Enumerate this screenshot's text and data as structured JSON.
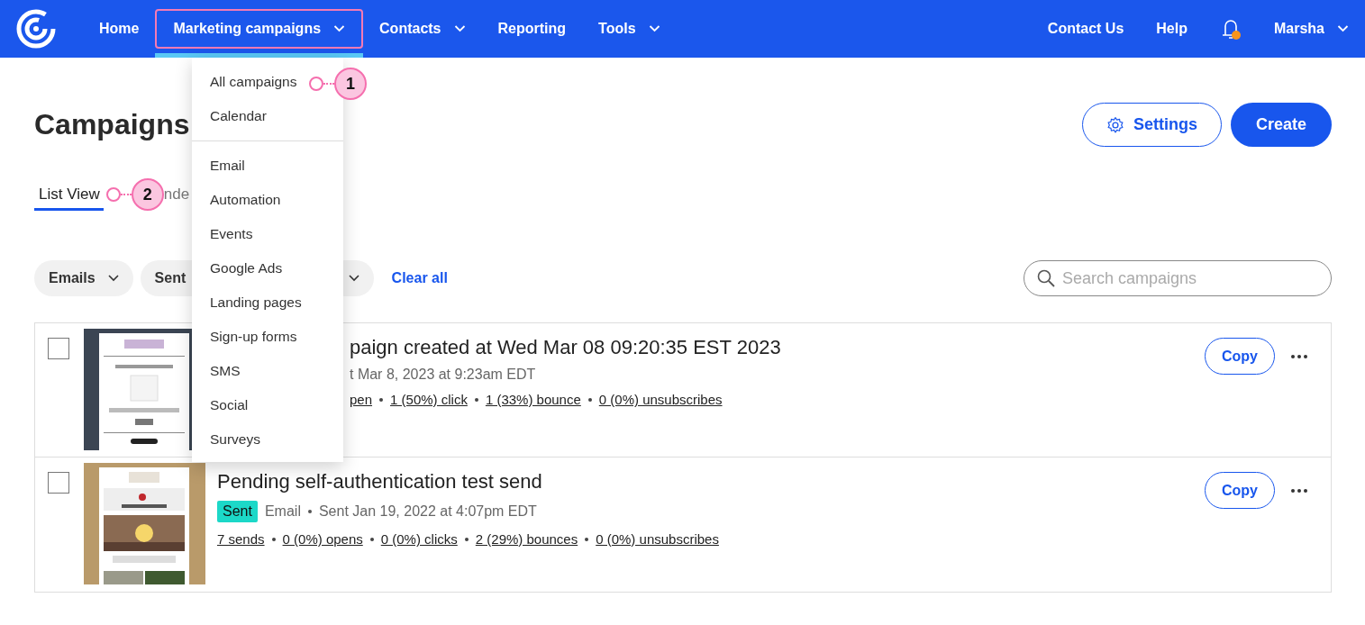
{
  "nav": {
    "items": [
      {
        "label": "Home",
        "dropdown": false,
        "selected": false
      },
      {
        "label": "Marketing campaigns",
        "dropdown": true,
        "selected": true
      },
      {
        "label": "Contacts",
        "dropdown": true,
        "selected": false
      },
      {
        "label": "Reporting",
        "dropdown": false,
        "selected": false
      },
      {
        "label": "Tools",
        "dropdown": true,
        "selected": false
      }
    ],
    "right": [
      {
        "label": "Contact Us"
      },
      {
        "label": "Help"
      }
    ],
    "notifications": true,
    "user": "Marsha"
  },
  "menu": {
    "groups": [
      [
        {
          "label": "All campaigns",
          "callout": "1"
        },
        {
          "label": "Calendar"
        }
      ],
      [
        {
          "label": "Email"
        },
        {
          "label": "Automation"
        },
        {
          "label": "Events"
        },
        {
          "label": "Google Ads"
        },
        {
          "label": "Landing pages"
        },
        {
          "label": "Sign-up forms"
        },
        {
          "label": "SMS"
        },
        {
          "label": "Social"
        },
        {
          "label": "Surveys"
        }
      ]
    ]
  },
  "heading": "Campaigns",
  "buttons": {
    "settings": "Settings",
    "create": "Create"
  },
  "tabs": [
    {
      "label": "List View",
      "selected": true,
      "callout": "2"
    },
    {
      "label": "nde",
      "selected": false
    }
  ],
  "filters": [
    {
      "label": "Emails"
    },
    {
      "label": "Sent"
    }
  ],
  "clear_all": "Clear all",
  "search": {
    "placeholder": "Search campaigns"
  },
  "rows": [
    {
      "checked": false,
      "partly_hidden": true,
      "title": "paign created at Wed Mar 08 09:20:35 EST 2023",
      "meta": [
        "t Mar 8, 2023 at 9:23am EDT"
      ],
      "stats": [
        "pen",
        "1 (50%) click",
        "1 (33%) bounce",
        "0 (0%) unsubscribes"
      ],
      "copy": "Copy"
    },
    {
      "checked": false,
      "partly_hidden": false,
      "title": "Pending self-authentication test send",
      "status": "Sent",
      "meta": [
        "Email",
        "Sent Jan 19, 2022 at 4:07pm EDT"
      ],
      "stats": [
        "7 sends",
        "0 (0%) opens",
        "0 (0%) clicks",
        "2 (29%) bounces",
        "0 (0%) unsubscribes"
      ],
      "copy": "Copy"
    }
  ]
}
